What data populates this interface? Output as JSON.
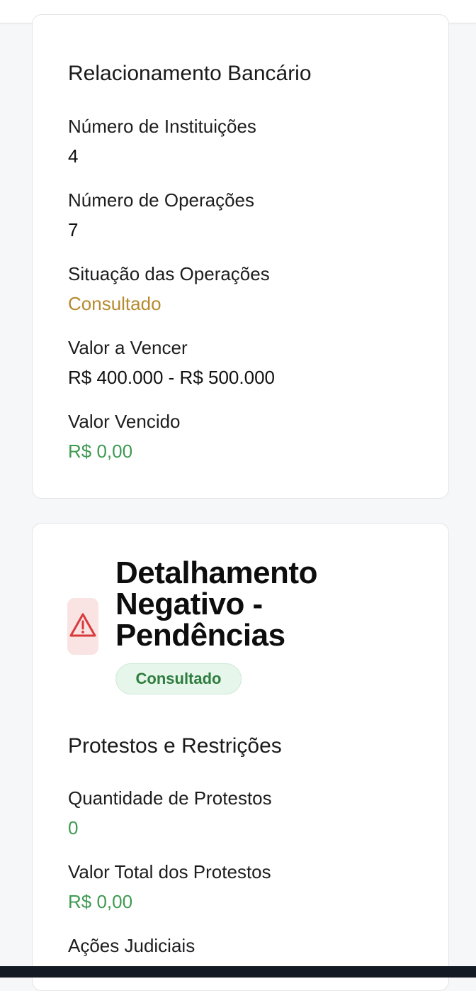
{
  "relacionamento": {
    "title": "Relacionamento Bancário",
    "fields": [
      {
        "label": "Número de Instituições",
        "value": "4"
      },
      {
        "label": "Número de Operações",
        "value": "7"
      },
      {
        "label": "Situação das Operações",
        "value": "Consultado"
      },
      {
        "label": "Valor a Vencer",
        "value": "R$ 400.000 - R$ 500.000"
      },
      {
        "label": "Valor Vencido",
        "value": "R$ 0,00"
      }
    ]
  },
  "detalhamento": {
    "title_lines": [
      "Detalhamento",
      "Negativo -",
      "Pendências"
    ],
    "icon": "warning-triangle-icon",
    "badge": "Consultado",
    "section_title": "Protestos e Restrições",
    "fields": [
      {
        "label": "Quantidade de Protestos",
        "value": "0"
      },
      {
        "label": "Valor Total dos Protestos",
        "value": "R$ 0,00"
      },
      {
        "label": "Ações Judiciais"
      }
    ]
  },
  "colors": {
    "amber": "#b58a2f",
    "green": "#3f9a52",
    "warning": "#d93a3a",
    "badge_bg": "#e6f6ea"
  }
}
